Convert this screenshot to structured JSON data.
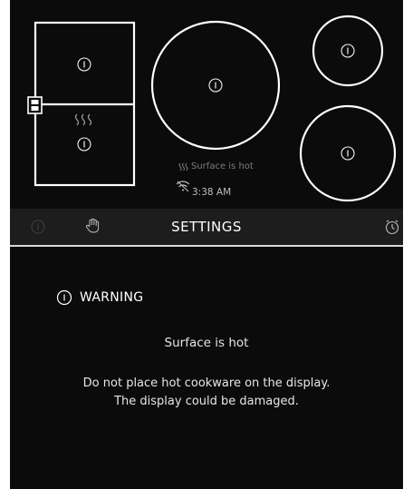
{
  "cooktop": {
    "status_text": "Surface is hot",
    "time_text": "3:38 AM"
  },
  "toolbar": {
    "title": "SETTINGS",
    "left_icon": "info-icon",
    "hand_icon": "hand-touch-icon",
    "timer_icon": "timer-clock-icon"
  },
  "warning": {
    "title": "WARNING",
    "heading": "Surface is hot",
    "line1": "Do not place hot cookware on the display.",
    "line2": "The display could be damaged."
  },
  "colors": {
    "background": "#0b0b0b",
    "toolbar": "#1d1d1d",
    "text": "#ffffff",
    "muted": "#7c7c7c"
  }
}
